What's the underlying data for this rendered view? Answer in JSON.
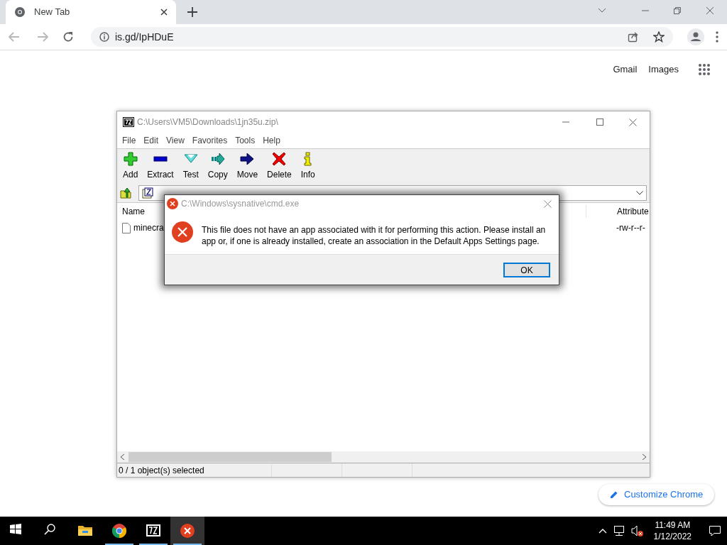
{
  "browser": {
    "tab": {
      "title": "New Tab",
      "selected": true
    },
    "address": "is.gd/IpHDuE",
    "links": [
      "Gmail",
      "Images"
    ],
    "customize_button": "Customize Chrome"
  },
  "archive_window": {
    "title": "C:\\Users\\VM5\\Downloads\\1jn35u.zip\\",
    "menu": [
      "File",
      "Edit",
      "View",
      "Favorites",
      "Tools",
      "Help"
    ],
    "toolbar": [
      {
        "label": "Add",
        "kind": "add"
      },
      {
        "label": "Extract",
        "kind": "extract"
      },
      {
        "label": "Test",
        "kind": "test"
      },
      {
        "label": "Copy",
        "kind": "copy"
      },
      {
        "label": "Move",
        "kind": "move"
      },
      {
        "label": "Delete",
        "kind": "delete"
      },
      {
        "label": "Info",
        "kind": "info"
      }
    ],
    "columns": [
      "Name",
      "Attribute"
    ],
    "rows": [
      {
        "name": "minecra",
        "attributes": "-rw-r--r-"
      }
    ],
    "status_bar": [
      "0 / 1 object(s) selected"
    ]
  },
  "dialog": {
    "title": "C:\\Windows\\sysnative\\cmd.exe",
    "message": "This file does not have an app associated with it for performing this action. Please install an app or, if one is already installed, create an association in the Default Apps Settings page.",
    "button": "OK"
  },
  "taskbar": {
    "apps": [
      {
        "kind": "start",
        "running": false,
        "selected": false
      },
      {
        "kind": "search",
        "running": false,
        "selected": false
      },
      {
        "kind": "explorer",
        "running": false,
        "selected": false
      },
      {
        "kind": "chrome",
        "running": true,
        "selected": false
      },
      {
        "kind": "sevenzip",
        "running": true,
        "selected": false
      },
      {
        "kind": "error",
        "running": true,
        "selected": true
      }
    ],
    "time": "11:49 AM",
    "date": "1/12/2022"
  }
}
